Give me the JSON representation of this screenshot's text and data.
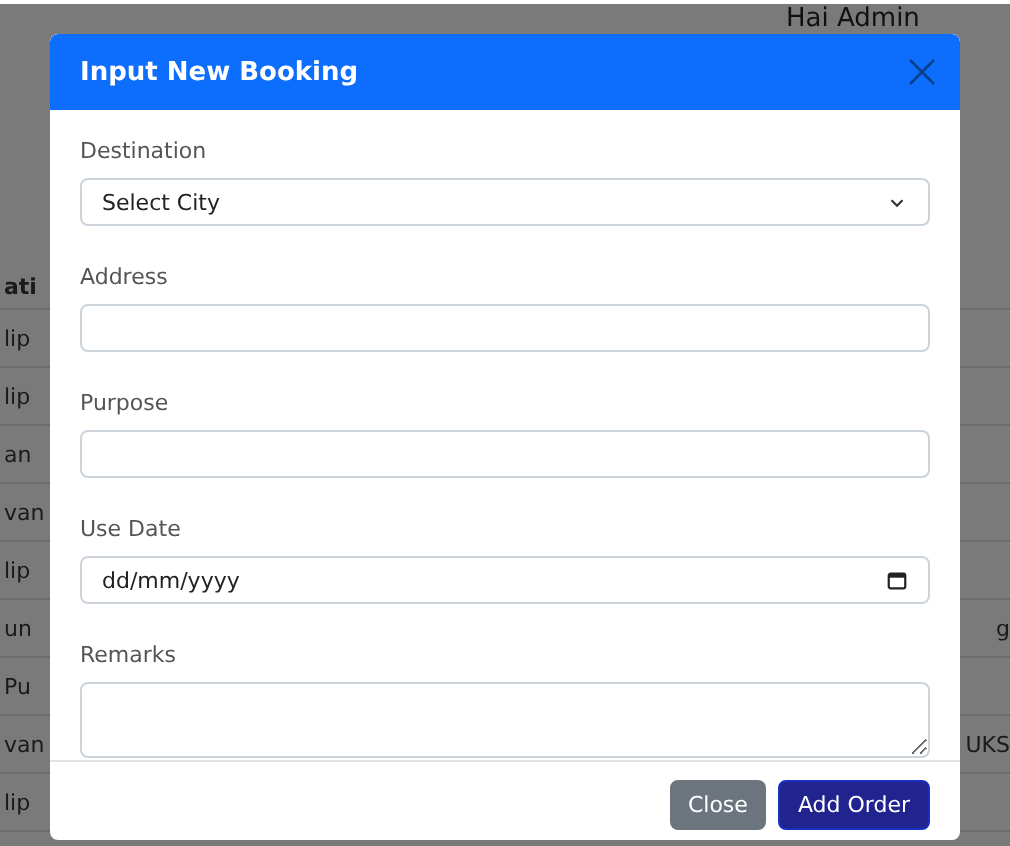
{
  "page": {
    "greeting": "Hai Admin",
    "table": {
      "header": "ati",
      "rows": [
        {
          "col_1": "lip"
        },
        {
          "col_1": "lip"
        },
        {
          "col_1": "an"
        },
        {
          "col_1": "van"
        },
        {
          "col_1": "lip"
        },
        {
          "col_1": "un",
          "col_2": "g"
        },
        {
          "col_1": "Pu"
        },
        {
          "col_1": "van",
          "col_2": "UKS"
        },
        {
          "col_1": "lip"
        }
      ]
    }
  },
  "modal": {
    "title": "Input New Booking",
    "fields": [
      {
        "kind": "select",
        "label": "Destination",
        "value": "Select City"
      },
      {
        "kind": "text",
        "label": "Address"
      },
      {
        "kind": "text",
        "label": "Purpose"
      },
      {
        "kind": "date",
        "label": "Use Date",
        "placeholder": "dd/mm/yyyy"
      },
      {
        "kind": "textarea",
        "label": "Remarks"
      }
    ],
    "buttons": [
      {
        "kind": "secondary",
        "label": "Close"
      },
      {
        "kind": "primary",
        "label": "Add Order"
      }
    ]
  }
}
